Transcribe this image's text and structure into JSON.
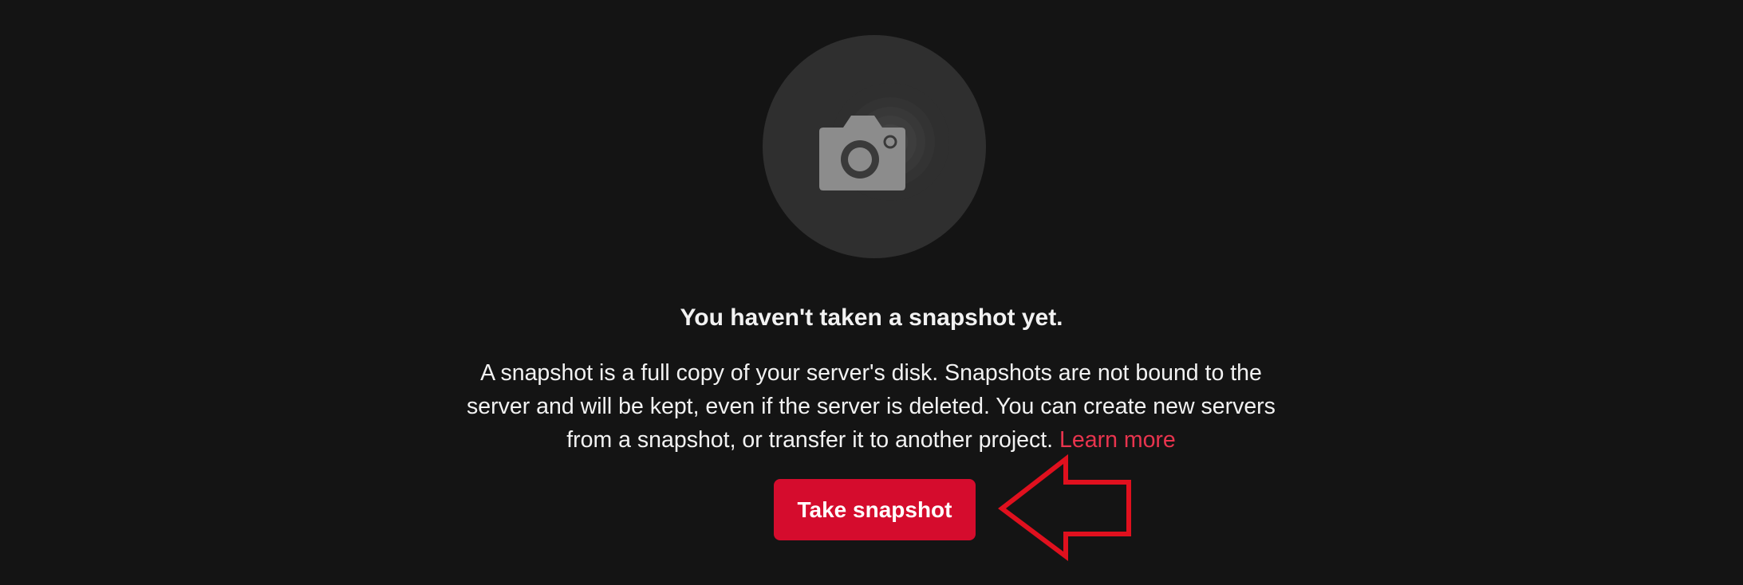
{
  "empty_state": {
    "icon": "camera-icon",
    "heading": "You haven't taken a snapshot yet.",
    "description": "A snapshot is a full copy of your server's disk. Snapshots are not bound to the server and will be kept, even if the server is deleted. You can create new servers from a snapshot, or transfer it to another project.",
    "learn_more": "Learn more",
    "button_label": "Take snapshot"
  },
  "colors": {
    "background": "#141414",
    "circle": "#2f2f2f",
    "accent": "#d50c2d",
    "link": "#e8344e",
    "text": "#f2f2f2",
    "annotation_arrow": "#e0101e"
  }
}
